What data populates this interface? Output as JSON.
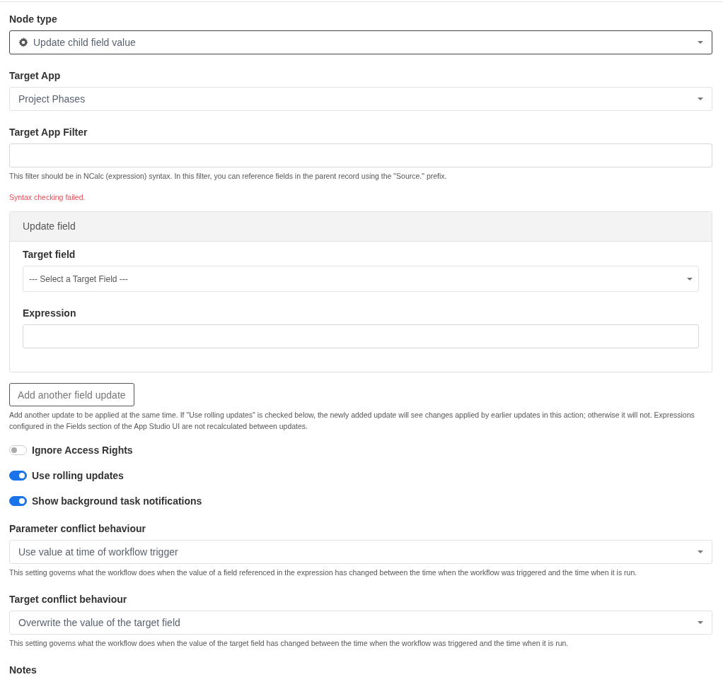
{
  "node_type": {
    "label": "Node type",
    "value": "Update child field value",
    "focused": true
  },
  "target_app": {
    "label": "Target App",
    "value": "Project Phases",
    "focused": false
  },
  "target_app_filter": {
    "label": "Target App Filter",
    "help": "This filter should be in NCalc (expression) syntax. In this filter, you can reference fields in the parent record using the \"Source.\" prefix.",
    "error": "Syntax checking failed."
  },
  "update_field_panel": {
    "title": "Update field",
    "target_field": {
      "label": "Target field",
      "placeholder": "--- Select a Target Field ---"
    },
    "expression": {
      "label": "Expression"
    }
  },
  "add_button": {
    "label": "Add another field update",
    "help": "Add another update to be applied at the same time. If \"Use rolling updates\" is checked below, the newly added update will see changes applied by earlier updates in this action; otherwise it will not. Expressions configured in the Fields section of the App Studio UI are not recalculated between updates."
  },
  "toggles": [
    {
      "label": "Ignore Access Rights",
      "on": false
    },
    {
      "label": "Use rolling updates",
      "on": true
    },
    {
      "label": "Show background task notifications",
      "on": true
    }
  ],
  "parameter_conflict": {
    "label": "Parameter conflict behaviour",
    "value": "Use value at time of workflow trigger",
    "focused": false,
    "help": "This setting governs what the workflow does when the value of a field referenced in the expression has changed between the time when the workflow was triggered and the time when it is run."
  },
  "target_conflict": {
    "label": "Target conflict behaviour",
    "value": "Overwrite the value of the target field",
    "focused": false,
    "help": "This setting governs what the workflow does when the value of the target field has changed between the time when the workflow was triggered and the time when it is run."
  },
  "notes": {
    "label": "Notes"
  }
}
